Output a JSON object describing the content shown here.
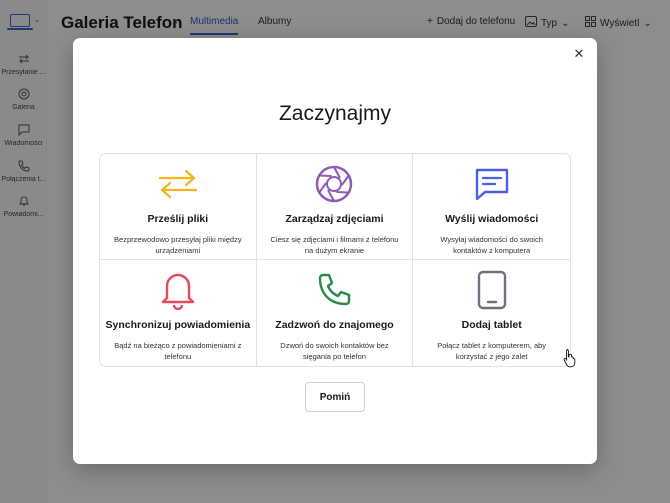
{
  "app": {
    "title": "Galeria Telefon",
    "tabs": [
      {
        "label": "Multimedia",
        "active": true
      },
      {
        "label": "Albumy",
        "active": false
      }
    ],
    "actions": {
      "add_to_phone": "Dodaj do telefonu",
      "type": "Typ",
      "view": "Wyświetl"
    },
    "sidebar": [
      {
        "label": "Przesyłanie ...",
        "icon": "arrows-icon"
      },
      {
        "label": "Galeria",
        "icon": "aperture-icon"
      },
      {
        "label": "Wiadomości",
        "icon": "message-icon"
      },
      {
        "label": "Połączenia t...",
        "icon": "phone-icon"
      },
      {
        "label": "Powiadomi...",
        "icon": "bell-icon"
      }
    ]
  },
  "dialog": {
    "title": "Zaczynajmy",
    "close_icon": "close-icon",
    "cards": [
      {
        "title": "Prześlij pliki",
        "desc": "Bezprzewodowo przesyłaj pliki między urządzeniami",
        "icon": "transfer-arrows-icon",
        "color": "#f2b51a"
      },
      {
        "title": "Zarządzaj zdjęciami",
        "desc": "Ciesz się zdjęciami i filmami z telefonu na dużym ekranie",
        "icon": "aperture-icon",
        "color": "#8e5bb0"
      },
      {
        "title": "Wyślij wiadomości",
        "desc": "Wysyłaj wiadomości do swoich kontaktów z komputera",
        "icon": "chat-bubble-icon",
        "color": "#4a5ee8"
      },
      {
        "title": "Synchronizuj powiadomienia",
        "desc": "Bądź na bieżąco z powiadomieniami z telefonu",
        "icon": "bell-icon",
        "color": "#e64a5a"
      },
      {
        "title": "Zadzwoń do znajomego",
        "desc": "Dzwoń do swoich kontaktów bez sięgania po telefon",
        "icon": "phone-icon",
        "color": "#2a8a4a"
      },
      {
        "title": "Dodaj tablet",
        "desc": "Połącz tablet z komputerem, aby korzystać z jego zalet",
        "icon": "tablet-icon",
        "color": "#6b7280"
      }
    ],
    "skip_label": "Pomiń"
  }
}
